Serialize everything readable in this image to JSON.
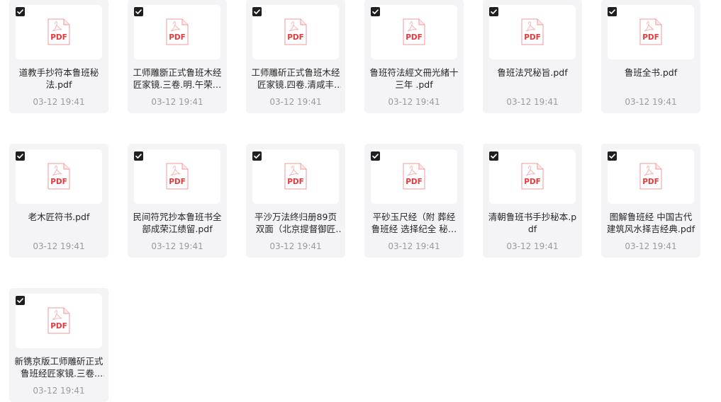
{
  "files": [
    {
      "name": "道教手抄符本鲁班秘法.pdf",
      "date": "03-12 19:41",
      "badge": "PDF",
      "checked": true
    },
    {
      "name": "工师雕斵正式鲁班木经匠家镜.三卷.明.午荣…",
      "date": "03-12 19:41",
      "badge": "PDF",
      "checked": true
    },
    {
      "name": "工师雕斫正式鲁班木经匠家镜.四卷.清咸丰十…",
      "date": "03-12 19:41",
      "badge": "PDF",
      "checked": true
    },
    {
      "name": "鲁班符法經文冊光緒十三年 .pdf",
      "date": "03-12 19:41",
      "badge": "PDF",
      "checked": true
    },
    {
      "name": "鲁班法咒秘旨.pdf",
      "date": "03-12 19:41",
      "badge": "PDF",
      "checked": true
    },
    {
      "name": "鲁班全书.pdf",
      "date": "03-12 19:41",
      "badge": "PDF",
      "checked": true
    },
    {
      "name": "老木匠符书.pdf",
      "date": "03-12 19:41",
      "badge": "PDF",
      "checked": true
    },
    {
      "name": "民间符咒抄本鲁班书全部成荣江绩留.pdf",
      "date": "03-12 19:41",
      "badge": "PDF",
      "checked": true
    },
    {
      "name": "平沙万法终归册89页双面（北京提督御匠司…",
      "date": "03-12 19:41",
      "badge": "PDF",
      "checked": true
    },
    {
      "name": "平砂玉尺经（附 葬经 鲁班经 选择纪全 秘…",
      "date": "03-12 19:41",
      "badge": "PDF",
      "checked": true
    },
    {
      "name": "清朝鲁班书手抄秘本.pdf",
      "date": "03-12 19:41",
      "badge": "PDF",
      "checked": true
    },
    {
      "name": "图解鲁班经 中国古代建筑风水择吉经典.pdf",
      "date": "03-12 19:41",
      "badge": "PDF",
      "checked": true
    },
    {
      "name": "新镌京版工师雕斫正式鲁班经匠家镜.三卷.明…",
      "date": "03-12 19:41",
      "badge": "PDF",
      "checked": true
    }
  ],
  "colors": {
    "pdf_red": "#e5393c",
    "card_bg": "#f4f4f6",
    "checkbox": "#1f1f1f"
  },
  "icons": {
    "checkbox": "checkbox-checked-icon",
    "file": "pdf-file-icon"
  }
}
